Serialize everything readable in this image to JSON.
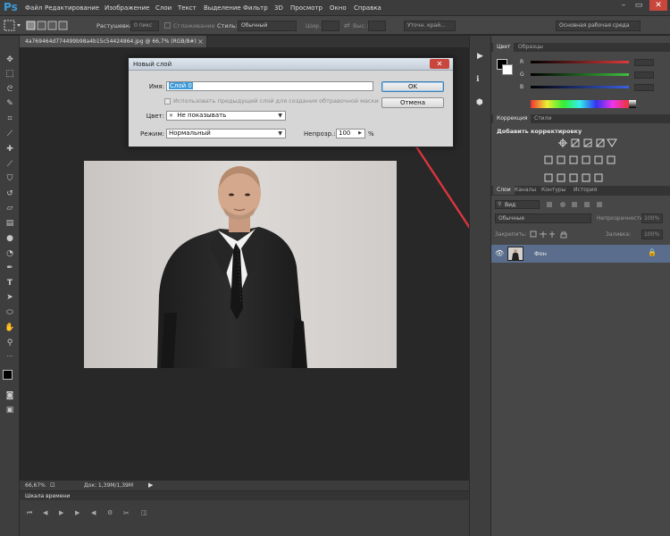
{
  "app": {
    "logo": "Ps"
  },
  "menu": [
    "Файл",
    "Редактирование",
    "Изображение",
    "Слои",
    "Текст",
    "Выделение",
    "Фильтр",
    "3D",
    "Просмотр",
    "Окно",
    "Справка"
  ],
  "window_controls": {
    "minimize": "–",
    "maximize": "▭",
    "close": "✕"
  },
  "options": {
    "feather_label": "Растушевка:",
    "feather_value": "0 пикс",
    "antialias_label": "Сглаживание",
    "style_label": "Стиль:",
    "style_value": "Обычный",
    "width_label": "Шир.:",
    "height_label": "Выс.:",
    "refine_button": "Уточн. край...",
    "workspace": "Основная рабочая среда"
  },
  "document": {
    "tab_title": "4a769464d774499b98a4b15c54424864.jpg @ 66,7% (RGB/8#)",
    "tab_close": "×",
    "zoom": "66,67%",
    "doc_size": "Док: 1,39M/1,39M",
    "timeline_title": "Шкала времени"
  },
  "dialog": {
    "title": "Новый слой",
    "close": "✕",
    "name_label": "Имя:",
    "name_value": "Слой 0",
    "clip_mask_label": "Использовать предыдущий слой для создания обтравочной маски",
    "color_label": "Цвет:",
    "color_value": "Не показывать",
    "color_x": "✕",
    "mode_label": "Режим:",
    "mode_value": "Нормальный",
    "opacity_label": "Непрозр.:",
    "opacity_value": "100",
    "opacity_unit": "%",
    "ok": "OK",
    "cancel": "Отмена"
  },
  "color_panel": {
    "tabs": [
      "Цвет",
      "Образцы"
    ],
    "channels": [
      {
        "label": "R",
        "color": "#e03a3a"
      },
      {
        "label": "G",
        "color": "#3fbf3f"
      },
      {
        "label": "B",
        "color": "#3b5fe0"
      }
    ]
  },
  "adjustments_panel": {
    "tabs": [
      "Коррекция",
      "Стили"
    ],
    "title": "Добавить корректировку"
  },
  "layers_panel": {
    "tabs": [
      "Слои",
      "Каналы",
      "Контуры",
      "История"
    ],
    "kind": "Вид",
    "blend": "Обычные",
    "opacity_label": "Непрозрачность:",
    "opacity_value": "100%",
    "lock_label": "Закрепить:",
    "fill_label": "Заливка:",
    "fill_value": "100%",
    "layer_name": "Фон"
  },
  "colors": {
    "accent": "#3d9ad8",
    "arrow": "#d9363e",
    "layer_selected": "#5a6d8c",
    "dialog_bg": "#d6d6d6"
  }
}
